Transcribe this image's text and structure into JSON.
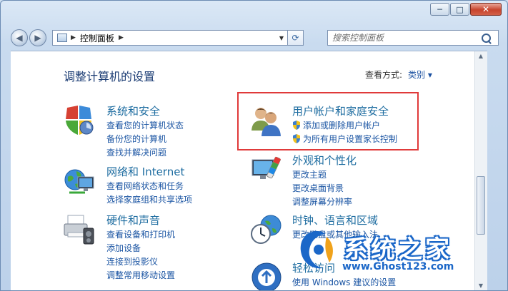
{
  "window": {
    "caption": {
      "minimize": "─",
      "maximize": "□",
      "close": "✕"
    }
  },
  "nav": {
    "back_glyph": "◀",
    "forward_glyph": "▶",
    "breadcrumb": [
      "控制面板"
    ],
    "separator": "▶",
    "search_placeholder": "搜索控制面板",
    "refresh_glyph": "⟳",
    "dropdown_glyph": "▼"
  },
  "header": {
    "title": "调整计算机的设置",
    "view_label": "查看方式:",
    "view_value": "类别 ▾"
  },
  "categories": [
    {
      "icon": "shield-icon",
      "title": "系统和安全",
      "links": [
        "查看您的计算机状态",
        "备份您的计算机",
        "查找并解决问题"
      ]
    },
    {
      "icon": "network-icon",
      "title": "网络和 Internet",
      "links": [
        "查看网络状态和任务",
        "选择家庭组和共享选项"
      ]
    },
    {
      "icon": "printer-icon",
      "title": "硬件和声音",
      "links": [
        "查看设备和打印机",
        "添加设备",
        "连接到投影仪",
        "调整常用移动设置"
      ]
    },
    {
      "icon": "users-icon",
      "title": "用户帐户和家庭安全",
      "links": [
        "添加或删除用户帐户",
        "为所有用户设置家长控制"
      ]
    },
    {
      "icon": "appearance-icon",
      "title": "外观和个性化",
      "links": [
        "更改主题",
        "更改桌面背景",
        "调整屏幕分辨率"
      ]
    },
    {
      "icon": "clock-icon",
      "title": "时钟、语言和区域",
      "links": [
        "更改键盘或其他输入法"
      ]
    },
    {
      "icon": "ease-of-access-icon",
      "title": "轻松访问",
      "links": [
        "使用 Windows 建议的设置"
      ]
    }
  ],
  "watermark": {
    "text": "系统之家",
    "url": "www.Ghost123.com"
  },
  "colors": {
    "highlight": "#e03a3a",
    "link": "#1b55a3",
    "category": "#1d6ca0"
  }
}
